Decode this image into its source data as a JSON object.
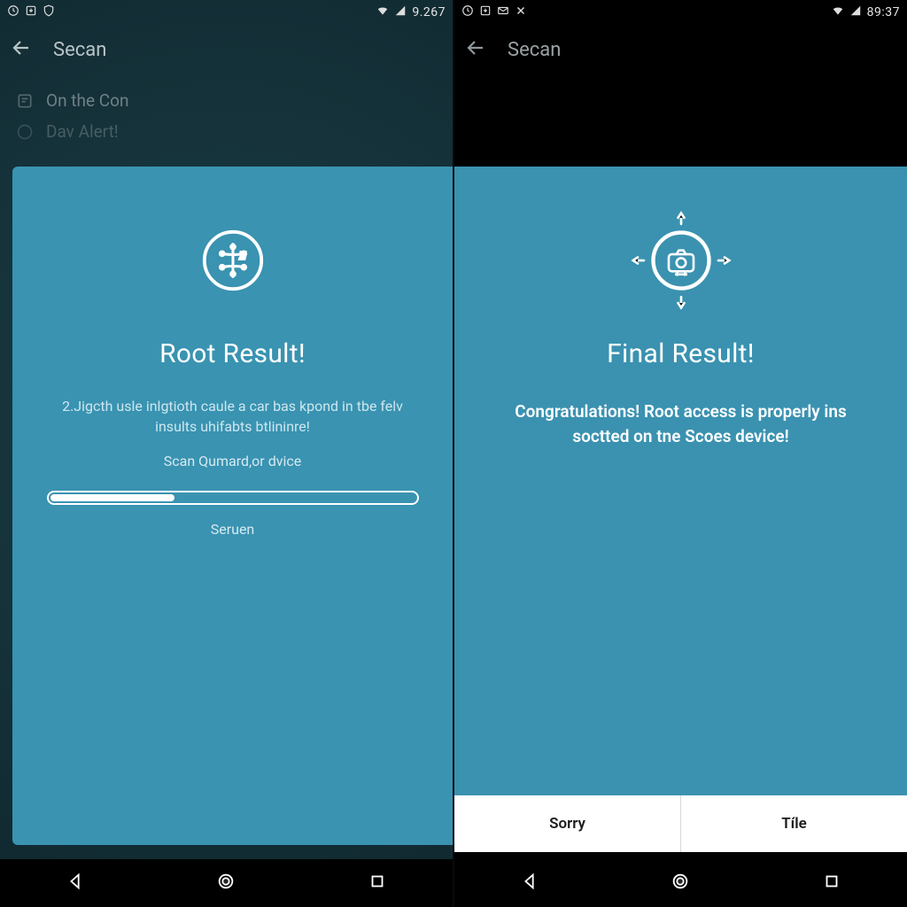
{
  "left": {
    "status": {
      "clock": "9.267"
    },
    "appbar": {
      "title": "Secan"
    },
    "bg": {
      "item1": "On the Con",
      "item2": "Dav Alert!"
    },
    "card": {
      "heading": "Root Result!",
      "desc": "2.Jigcth usle inlgtioth caule a car bas kpond in tbe felv insults uhifabts btlininre!",
      "sub": "Scan Qumard,or dvice",
      "progress_percent": 34,
      "status": "Seruen"
    }
  },
  "right": {
    "status": {
      "clock": "89:37"
    },
    "appbar": {
      "title": "Secan"
    },
    "card": {
      "heading": "Final Result!",
      "desc": "Congratulations! Root access is properly ins soctted on tne Scoes device!"
    },
    "buttons": {
      "negative": "Sorry",
      "positive": "Tíle"
    }
  }
}
